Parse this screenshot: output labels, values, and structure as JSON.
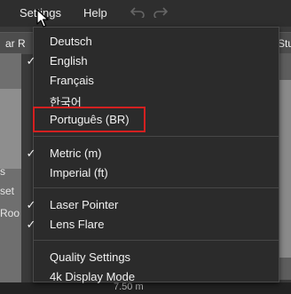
{
  "menubar": {
    "settings_label": "Settings",
    "help_label": "Help",
    "undo_icon": "undo-icon",
    "redo_icon": "redo-icon"
  },
  "background": {
    "tab_left": "ar R",
    "tab_right": "Stu",
    "left_text_1": "s",
    "left_text_2": "set",
    "left_text_3": "Roo",
    "coordinate": "7.50 m"
  },
  "dropdown": {
    "items": [
      {
        "label": "Deutsch",
        "checked": false
      },
      {
        "label": "English",
        "checked": true
      },
      {
        "label": "Français",
        "checked": false
      },
      {
        "label": "한국어",
        "checked": false
      },
      {
        "label": "Português (BR)",
        "checked": false
      },
      {
        "label": "Metric (m)",
        "checked": true
      },
      {
        "label": "Imperial (ft)",
        "checked": false
      },
      {
        "label": "Laser Pointer",
        "checked": true
      },
      {
        "label": "Lens Flare",
        "checked": true
      },
      {
        "label": "Quality Settings",
        "checked": false
      },
      {
        "label": "4k Display Mode",
        "checked": false
      }
    ],
    "check_glyph": "✓"
  },
  "colors": {
    "highlight": "#d42020",
    "menu_bg": "#2b2b2b"
  }
}
